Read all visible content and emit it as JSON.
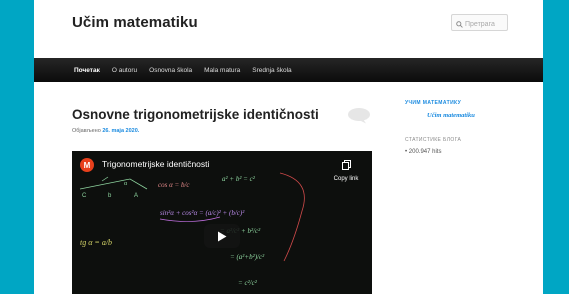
{
  "site": {
    "title": "Učim matematiku"
  },
  "search": {
    "placeholder": "Претрага"
  },
  "nav": {
    "items": [
      {
        "label": "Почетак",
        "active": true
      },
      {
        "label": "O autoru",
        "active": false
      },
      {
        "label": "Osnovna škola",
        "active": false
      },
      {
        "label": "Mala matura",
        "active": false
      },
      {
        "label": "Srednja škola",
        "active": false
      }
    ]
  },
  "post": {
    "title": "Osnovne trigonometrijske identičnosti",
    "meta_prefix": "Објављено",
    "date": "26. maja 2020."
  },
  "video": {
    "title": "Trigonometrijske identičnosti",
    "logo_letter": "M",
    "copy_link_label": "Copy link",
    "board": {
      "eq1": "a² + b² = c²",
      "eq2": "cos α = b/c",
      "eq3": "sin²α + cos²α = (a/c)² + (b/c)²",
      "eq4": "tg α = a/b",
      "eq5": "= a²/c² + b²/c²",
      "eq6": "= (a²+b²)/c²",
      "eq7": "= c²/c²",
      "labels": [
        "C",
        "b",
        "A",
        "α"
      ]
    }
  },
  "sidebar": {
    "widget1_title": "УЧИМ МАТЕМАТИКУ",
    "widget1_link": "Učim matematiku",
    "widget2_title": "СТАТИСТИКЕ БЛОГА",
    "hits": "200.947 hits"
  },
  "colors": {
    "accent": "#00a6c4",
    "link": "#1b8be0",
    "nav_bg": "#1a1a1a"
  }
}
